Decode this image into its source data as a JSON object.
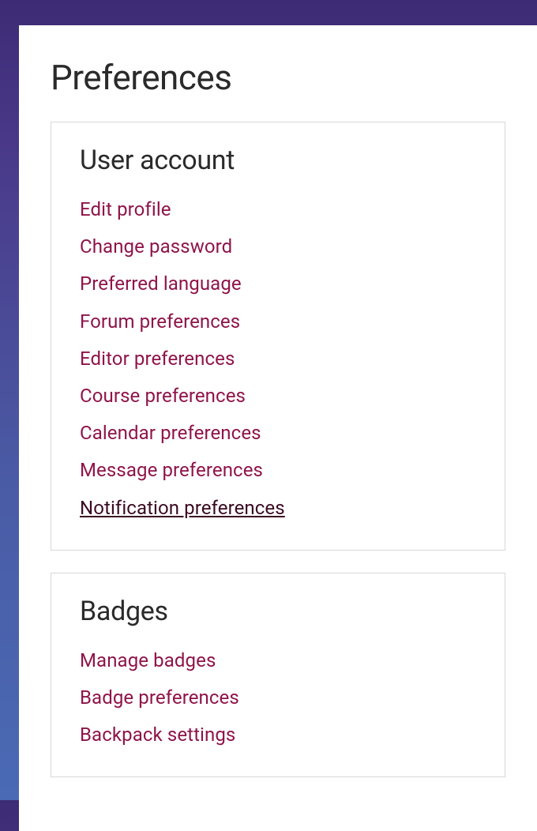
{
  "page": {
    "title": "Preferences"
  },
  "sections": {
    "user_account": {
      "title": "User account",
      "links": {
        "edit_profile": "Edit profile",
        "change_password": "Change password",
        "preferred_language": "Preferred language",
        "forum_preferences": "Forum preferences",
        "editor_preferences": "Editor preferences",
        "course_preferences": "Course preferences",
        "calendar_preferences": "Calendar preferences",
        "message_preferences": "Message preferences",
        "notification_preferences": "Notification preferences"
      }
    },
    "badges": {
      "title": "Badges",
      "links": {
        "manage_badges": "Manage badges",
        "badge_preferences": "Badge preferences",
        "backpack_settings": "Backpack settings"
      }
    }
  }
}
